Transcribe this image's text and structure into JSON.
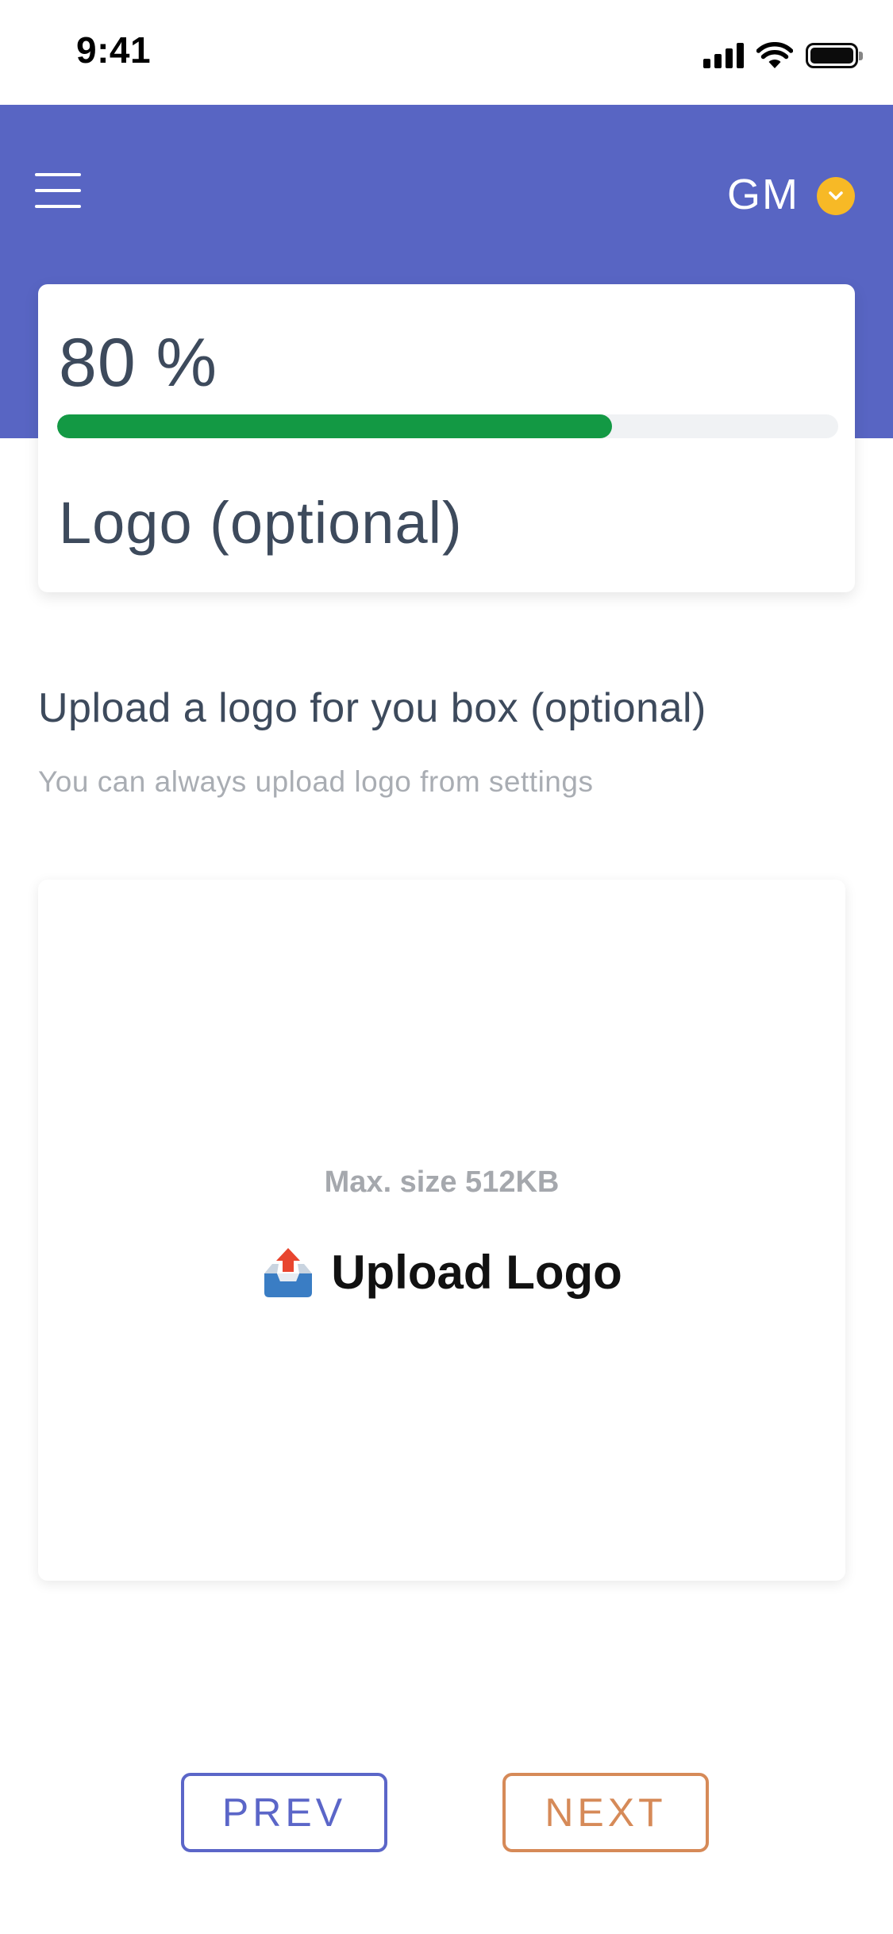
{
  "status_bar": {
    "time": "9:41"
  },
  "header": {
    "user_initials": "GM",
    "accent_color": "#5865c3",
    "avatar_badge_color": "#f7b926"
  },
  "progress": {
    "percent_label": "80 %",
    "value_fraction": 0.71,
    "fill_color": "#139944",
    "step_title": "Logo (optional)"
  },
  "section": {
    "heading": "Upload a logo for you box (optional)",
    "subheading": "You can always upload logo from settings"
  },
  "upload": {
    "max_size_label": "Max. size 512KB",
    "button_label": "Upload Logo",
    "icon": "outbox-tray-icon"
  },
  "nav": {
    "prev_label": "PREV",
    "next_label": "NEXT",
    "prev_color": "#5b66c8",
    "next_color": "#d68a58"
  }
}
